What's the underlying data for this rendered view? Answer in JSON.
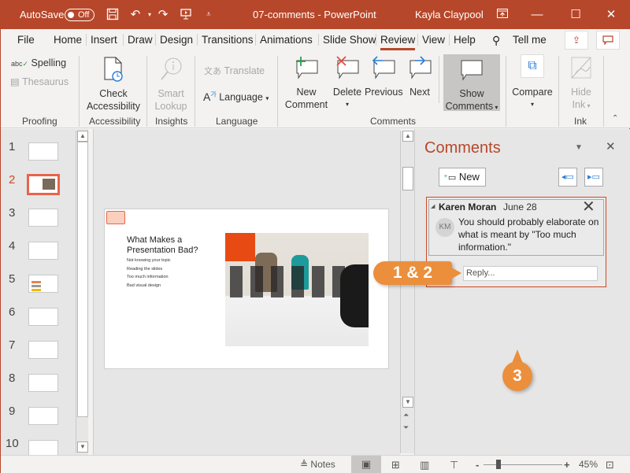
{
  "titlebar": {
    "autosave_label": "AutoSave",
    "autosave_state": "Off",
    "document_title": "07-comments  -  PowerPoint",
    "user_name": "Kayla Claypool",
    "icons": [
      "save-icon",
      "undo-icon",
      "redo-icon",
      "start-presentation-icon",
      "customize-qat-icon",
      "ribbon-display-icon",
      "minimize-icon",
      "maximize-icon",
      "close-icon"
    ]
  },
  "tabs": [
    {
      "label": "File"
    },
    {
      "label": "Home"
    },
    {
      "label": "Insert"
    },
    {
      "label": "Draw"
    },
    {
      "label": "Design"
    },
    {
      "label": "Transitions"
    },
    {
      "label": "Animations"
    },
    {
      "label": "Slide Show"
    },
    {
      "label": "Review",
      "active": true
    },
    {
      "label": "View"
    },
    {
      "label": "Help"
    }
  ],
  "tell_me": "Tell me",
  "ribbon": {
    "proofing": {
      "spelling": "Spelling",
      "thesaurus": "Thesaurus",
      "group": "Proofing"
    },
    "accessibility": {
      "check": "Check",
      "check2": "Accessibility",
      "group": "Accessibility"
    },
    "insights": {
      "smart": "Smart",
      "smart2": "Lookup",
      "group": "Insights"
    },
    "language": {
      "translate": "Translate",
      "language": "Language",
      "group": "Language"
    },
    "comments": {
      "new": "New",
      "new2": "Comment",
      "delete": "Delete",
      "previous": "Previous",
      "next": "Next",
      "show": "Show",
      "show2": "Comments",
      "group": "Comments"
    },
    "compare": {
      "label": "Compare"
    },
    "ink": {
      "hide": "Hide",
      "hide2": "Ink",
      "group": "Ink"
    }
  },
  "slides": {
    "numbers": [
      "1",
      "2",
      "3",
      "4",
      "5",
      "6",
      "7",
      "8",
      "9",
      "10"
    ],
    "selected": "2"
  },
  "slide": {
    "title": "What Makes a Presentation Bad?",
    "bullets": [
      "Not knowing your topic",
      "Reading the slides",
      "Too much information",
      "Bad visual design"
    ]
  },
  "comments_pane": {
    "title": "Comments",
    "new_button": "New",
    "comment": {
      "author": "Karen Moran",
      "date": "June 28",
      "initials": "KM",
      "text": "You should probably elaborate on what is meant by \"Too much information.\""
    },
    "reply_placeholder": "Reply..."
  },
  "callouts": {
    "one_two": "1 & 2",
    "three": "3"
  },
  "statusbar": {
    "notes": "Notes",
    "zoom_level": "45%",
    "zoom_minus": "-",
    "zoom_plus": "+"
  },
  "colors": {
    "accent": "#b7472a",
    "callout": "#eb8f3c",
    "selection": "#e8644a"
  }
}
